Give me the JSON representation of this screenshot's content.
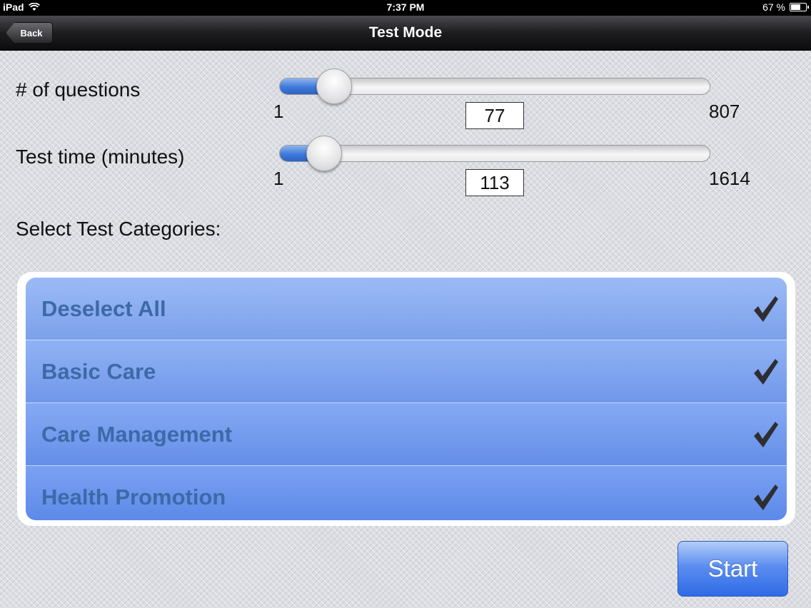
{
  "status_bar": {
    "device": "iPad",
    "time": "7:37 PM",
    "battery": "67 %",
    "battery_level": 0.67
  },
  "nav": {
    "back_label": "Back",
    "title": "Test Mode"
  },
  "questions": {
    "label": "# of questions",
    "min": "1",
    "max": "807",
    "value": "77",
    "fraction": 0.094
  },
  "test_time": {
    "label": "Test time (minutes)",
    "min": "1",
    "max": "1614",
    "value": "113",
    "fraction": 0.069
  },
  "categories": {
    "heading": "Select Test Categories:",
    "items": [
      {
        "label": "Deselect All",
        "checked": true
      },
      {
        "label": "Basic Care",
        "checked": true
      },
      {
        "label": "Care Management",
        "checked": true
      },
      {
        "label": "Health Promotion",
        "checked": true
      }
    ]
  },
  "start_label": "Start",
  "colors": {
    "accent": "#3f79d9",
    "category_text": "#3d6aa7",
    "checkmark": "#2e2e32"
  }
}
